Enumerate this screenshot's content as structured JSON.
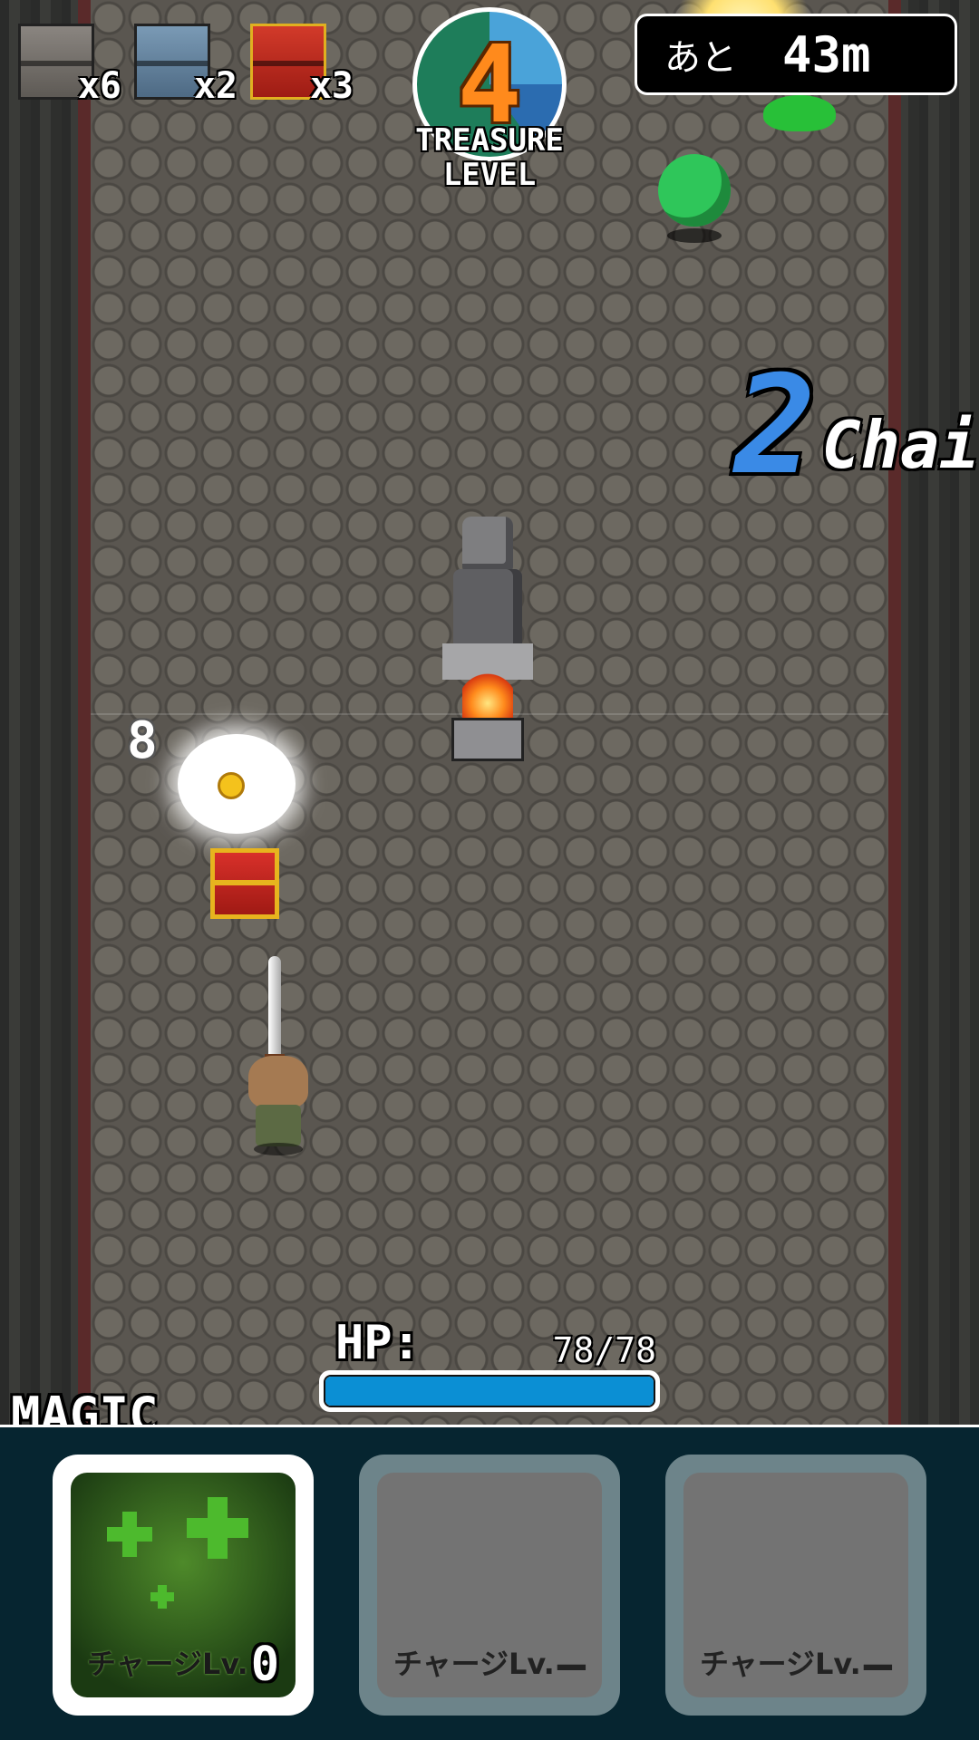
{
  "inventory": [
    {
      "icon": "gray-chest-icon",
      "count": "x6"
    },
    {
      "icon": "blue-chest-icon",
      "count": "x2"
    },
    {
      "icon": "red-chest-icon",
      "count": "x3"
    }
  ],
  "treasure": {
    "level": "4",
    "label_line1": "TREASURE",
    "label_line2": "LEVEL"
  },
  "distance": {
    "prefix": "あと",
    "value": "43m"
  },
  "chain": {
    "count": "2",
    "label": "Chai"
  },
  "burst": {
    "text": "8"
  },
  "hp": {
    "label": "HP:",
    "current": 78,
    "max": 78,
    "text": "78/78",
    "color": "#0b8fd4"
  },
  "magic": {
    "label": "MAGIC",
    "slots": [
      {
        "name": "heal-magic",
        "charge_label": "チャージLv.",
        "level": "0",
        "active": true
      },
      {
        "name": "empty",
        "charge_label": "チャージLv.",
        "level": "—",
        "active": false
      },
      {
        "name": "empty",
        "charge_label": "チャージLv.",
        "level": "—",
        "active": false
      }
    ]
  }
}
